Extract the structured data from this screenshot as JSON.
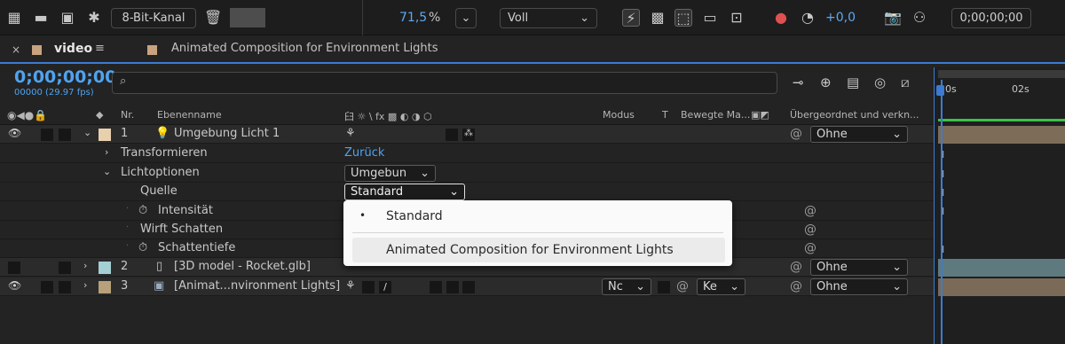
{
  "toolbar": {
    "channel_label": "8-Bit-Kanal",
    "zoom": "71,5",
    "zoom_unit": "%",
    "resolution": "Voll",
    "exposure": "+0,0",
    "timecode": "0;00;00;00"
  },
  "panel": {
    "tab_name": "video",
    "comp_name": "Animated Composition for Environment Lights"
  },
  "timecode": {
    "value": "0;00;00;00",
    "sub": "00000 (29.97 fps)"
  },
  "columns": {
    "nr": "Nr.",
    "name": "Ebenenname",
    "switches": "⾅ ☼ \\ fx ▩ ◐ ◑ ⬡",
    "modus": "Modus",
    "t": "T",
    "matte": "Bewegte Ma...",
    "parent": "Übergeordnet und verkn..."
  },
  "timeline": {
    "tick0": "0s",
    "tick1": "02s"
  },
  "layers": [
    {
      "num": "1",
      "name": "Umgebung Licht 1",
      "color": "#e8cfae",
      "parent": "Ohne"
    },
    {
      "num": "2",
      "name": "[3D model - Rocket.glb]",
      "color": "#a4d0d4",
      "parent": "Ohne"
    },
    {
      "num": "3",
      "name": "[Animat...nvironment Lights]",
      "color": "#b8a07a",
      "parent": "Ohne",
      "mode": "Nc",
      "matte": "Ke"
    }
  ],
  "props": {
    "transform": "Transformieren",
    "transform_link": "Zurück",
    "light_options": "Lichtoptionen",
    "light_type": "Umgebun",
    "source": "Quelle",
    "source_value": "Standard",
    "intensity": "Intensität",
    "casts_shadows": "Wirft Schatten",
    "shadow_depth": "Schattentiefe"
  },
  "popup": {
    "items": [
      {
        "label": "Standard",
        "selected": true
      },
      {
        "label": "Animated Composition for Environment Lights",
        "selected": false
      }
    ]
  },
  "colors": {
    "accent_blue": "#4fa3f0",
    "timeline_bar_green": "#3fbf4a",
    "track_tan": "#7d6c58",
    "track_teal": "#5e7a7e"
  }
}
